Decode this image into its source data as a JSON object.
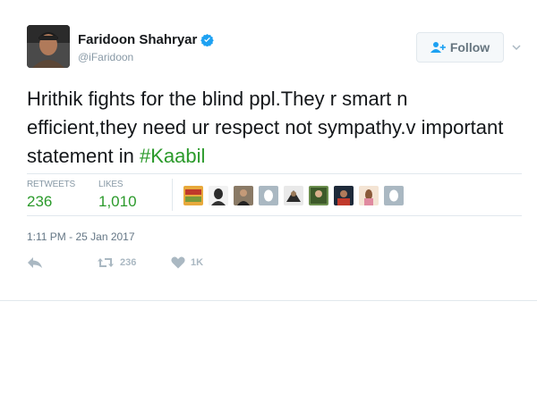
{
  "tweet": {
    "display_name": "Faridoon Shahryar",
    "handle": "@iFaridoon",
    "follow_label": "Follow",
    "text_plain": "Hrithik fights for the blind ppl.They r smart n efficient,they need ur respect not sympathy.v important statement in ",
    "hashtag": "#Kaabil",
    "timestamp": "1:11 PM - 25 Jan 2017"
  },
  "stats": {
    "retweets_label": "RETWEETS",
    "retweets_value": "236",
    "likes_label": "LIKES",
    "likes_value": "1,010"
  },
  "actions": {
    "retweet_count": "236",
    "like_count": "1K"
  },
  "icons": [
    "verified-icon",
    "follow-icon",
    "chevron-down-icon",
    "reply-icon",
    "retweet-icon",
    "heart-icon"
  ],
  "colors": {
    "hashtag": "#2b9a2b",
    "verified": "#1da1f2",
    "muted": "#8899a6",
    "divider": "#e1e8ed"
  }
}
